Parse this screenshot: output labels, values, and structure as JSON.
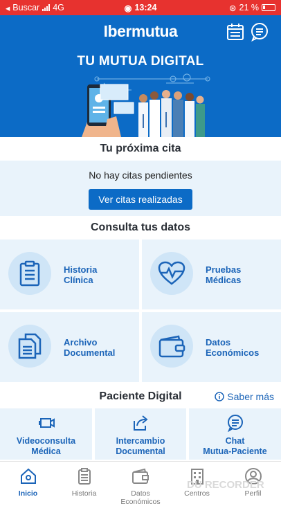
{
  "status_bar": {
    "carrier": "Buscar",
    "network": "4G",
    "time": "13:24",
    "battery": "21 %"
  },
  "header": {
    "logo": "Ibermutua",
    "calendar_icon": "calendar-icon",
    "chat_icon": "chat-icon"
  },
  "banner": {
    "title": "TU MUTUA DIGITAL"
  },
  "cita": {
    "title": "Tu próxima cita",
    "empty_text": "No hay citas pendientes",
    "button": "Ver citas realizadas"
  },
  "consulta": {
    "title": "Consulta tus datos",
    "tiles": [
      {
        "line1": "Historia",
        "line2": "Clínica",
        "icon": "clipboard-icon"
      },
      {
        "line1": "Pruebas",
        "line2": "Médicas",
        "icon": "heart-pulse-icon"
      },
      {
        "line1": "Archivo",
        "line2": "Documental",
        "icon": "documents-icon"
      },
      {
        "line1": "Datos",
        "line2": "Económicos",
        "icon": "wallet-icon"
      }
    ]
  },
  "paciente": {
    "title": "Paciente Digital",
    "saber_mas": "Saber más",
    "tiles": [
      {
        "line1": "Videoconsulta",
        "line2": "Médica",
        "icon": "video-icon"
      },
      {
        "line1": "Intercambio",
        "line2": "Documental",
        "icon": "share-icon"
      },
      {
        "line1": "Chat",
        "line2": "Mutua-Paciente",
        "icon": "chat-icon"
      }
    ]
  },
  "tabbar": {
    "items": [
      {
        "label": "Inicio",
        "icon": "home-icon",
        "active": true
      },
      {
        "label": "Historia",
        "icon": "clipboard-icon",
        "active": false
      },
      {
        "label": "Datos Económicos",
        "icon": "wallet-icon",
        "active": false
      },
      {
        "label": "Centros",
        "icon": "building-icon",
        "active": false
      },
      {
        "label": "Perfil",
        "icon": "user-icon",
        "active": false
      }
    ]
  },
  "watermark": "DU RECORDER",
  "colors": {
    "status_bar": "#e7322f",
    "brand_blue": "#0c6bc6",
    "tile_bg": "#e9f3fb",
    "link_blue": "#1b64b8"
  }
}
